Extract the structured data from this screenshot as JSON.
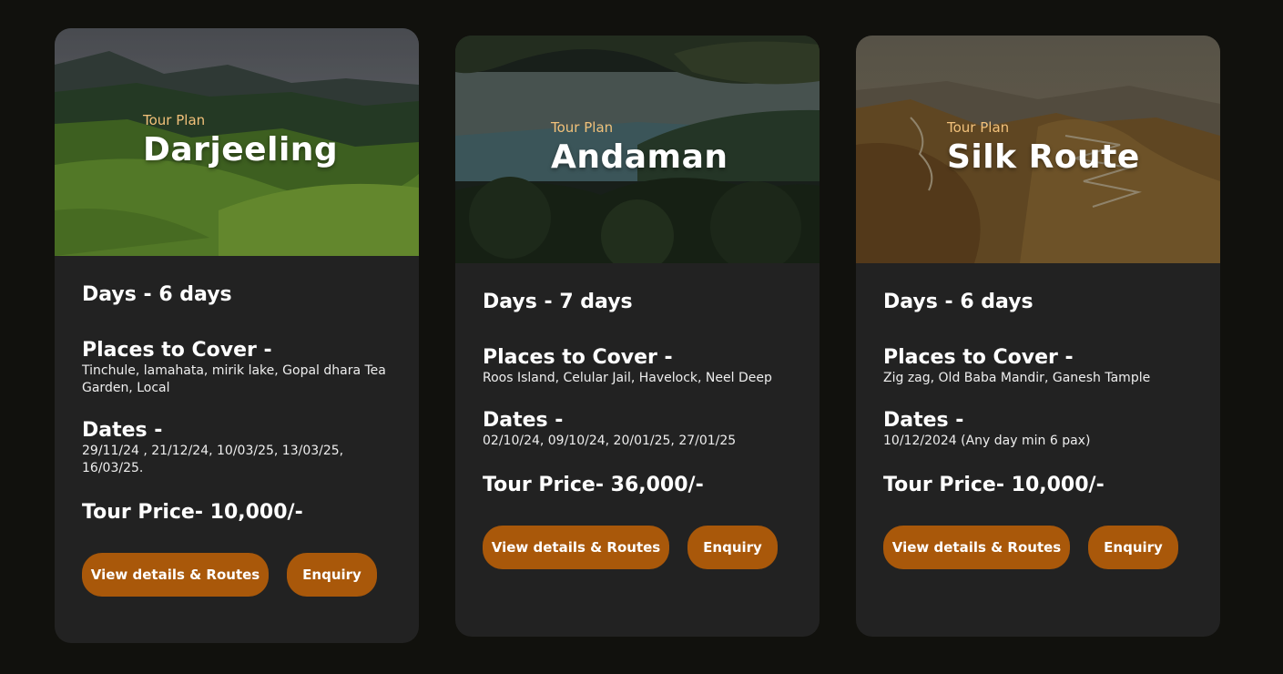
{
  "tours": [
    {
      "kicker": "Tour Plan",
      "place": "Darjeeling",
      "days": "Days - 6 days",
      "places_heading": "Places to Cover -",
      "places": "Tinchule, lamahata, mirik lake, Gopal dhara Tea Garden, Local",
      "dates_heading": "Dates -",
      "dates": "29/11/24 , 21/12/24, 10/03/25, 13/03/25, 16/03/25.",
      "price": "Tour Price- 10,000/-",
      "view_label": "View details & Routes",
      "enquiry_label": "Enquiry"
    },
    {
      "kicker": "Tour Plan",
      "place": "Andaman",
      "days": "Days - 7 days",
      "places_heading": "Places to Cover -",
      "places": "Roos Island, Celular Jail, Havelock, Neel Deep",
      "dates_heading": "Dates -",
      "dates": "02/10/24, 09/10/24, 20/01/25, 27/01/25",
      "price": "Tour Price- 36,000/-",
      "view_label": "View details & Routes",
      "enquiry_label": "Enquiry"
    },
    {
      "kicker": "Tour Plan",
      "place": "Silk Route",
      "days": "Days - 6 days",
      "places_heading": "Places to Cover -",
      "places": "Zig zag, Old Baba Mandir, Ganesh Tample",
      "dates_heading": "Dates -",
      "dates": "10/12/2024 (Any day min 6 pax)",
      "price": "Tour Price- 10,000/-",
      "view_label": "View details & Routes",
      "enquiry_label": "Enquiry"
    }
  ],
  "colors": {
    "page_bg": "#11110d",
    "card_bg": "#222222",
    "accent_button": "#a9580a",
    "kicker": "#f2c17a"
  }
}
